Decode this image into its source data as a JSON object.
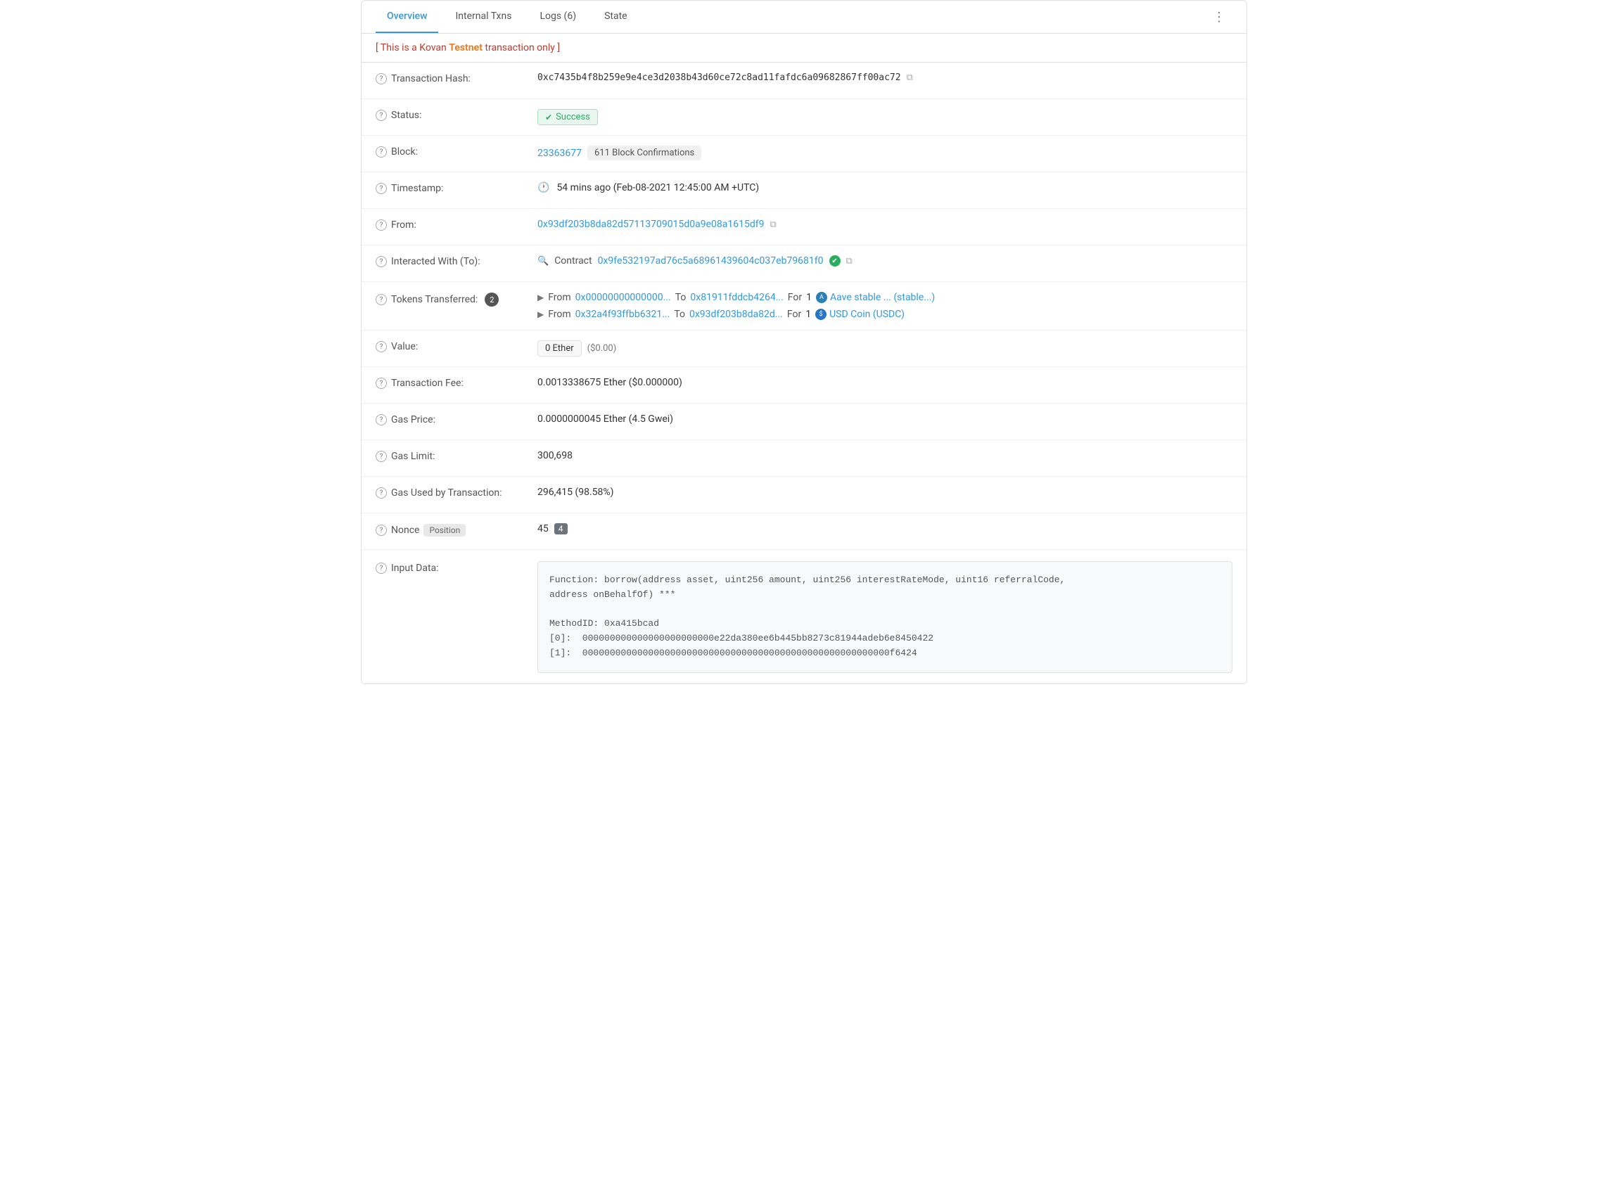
{
  "tabs": {
    "items": [
      {
        "id": "overview",
        "label": "Overview",
        "active": true
      },
      {
        "id": "internal-txns",
        "label": "Internal Txns",
        "active": false
      },
      {
        "id": "logs",
        "label": "Logs (6)",
        "active": false
      },
      {
        "id": "state",
        "label": "State",
        "active": false
      }
    ]
  },
  "alert": {
    "text": "[ This is a Kovan ",
    "brand": "Testnet",
    "suffix": " transaction only ]"
  },
  "fields": {
    "transaction_hash": {
      "label": "Transaction Hash:",
      "value": "0xc7435b4f8b259e9e4ce3d2038b43d60ce72c8ad11fafdc6a09682867ff00ac72"
    },
    "status": {
      "label": "Status:",
      "badge": "Success"
    },
    "block": {
      "label": "Block:",
      "number": "23363677",
      "confirmations": "611 Block Confirmations"
    },
    "timestamp": {
      "label": "Timestamp:",
      "value": "54 mins ago (Feb-08-2021 12:45:00 AM +UTC)"
    },
    "from": {
      "label": "From:",
      "value": "0x93df203b8da82d57113709015d0a9e08a1615df9"
    },
    "interacted_with": {
      "label": "Interacted With (To):",
      "contract_prefix": "Contract",
      "contract_address": "0x9fe532197ad76c5a68961439604c037eb79681f0"
    },
    "tokens_transferred": {
      "label": "Tokens Transferred:",
      "count": "2",
      "transfers": [
        {
          "from": "0x00000000000000...",
          "to": "0x81911fddcb4264...",
          "for": "1",
          "token": "Aave stable ... (stable...)"
        },
        {
          "from": "0x32a4f93ffbb6321...",
          "to": "0x93df203b8da82d...",
          "for": "1",
          "token": "USD Coin (USDC)"
        }
      ]
    },
    "value": {
      "label": "Value:",
      "amount": "0 Ether",
      "usd": "($0.00)"
    },
    "transaction_fee": {
      "label": "Transaction Fee:",
      "value": "0.0013338675 Ether ($0.000000)"
    },
    "gas_price": {
      "label": "Gas Price:",
      "value": "0.0000000045 Ether (4.5 Gwei)"
    },
    "gas_limit": {
      "label": "Gas Limit:",
      "value": "300,698"
    },
    "gas_used": {
      "label": "Gas Used by Transaction:",
      "value": "296,415 (98.58%)"
    },
    "nonce": {
      "label": "Nonce",
      "position_label": "Position",
      "nonce_value": "45",
      "position_value": "4"
    },
    "input_data": {
      "label": "Input Data:",
      "content": "Function: borrow(address asset, uint256 amount, uint256 interestRateMode, uint16 referralCode,\naddress onBehalfOf) ***\n\nMethodID: 0xa415bcad\n[0]:  000000000000000000000000e22da380ee6b445bb8273c81944adeb6e8450422\n[1]:  00000000000000000000000000000000000000000000000000000000f6424"
    }
  }
}
